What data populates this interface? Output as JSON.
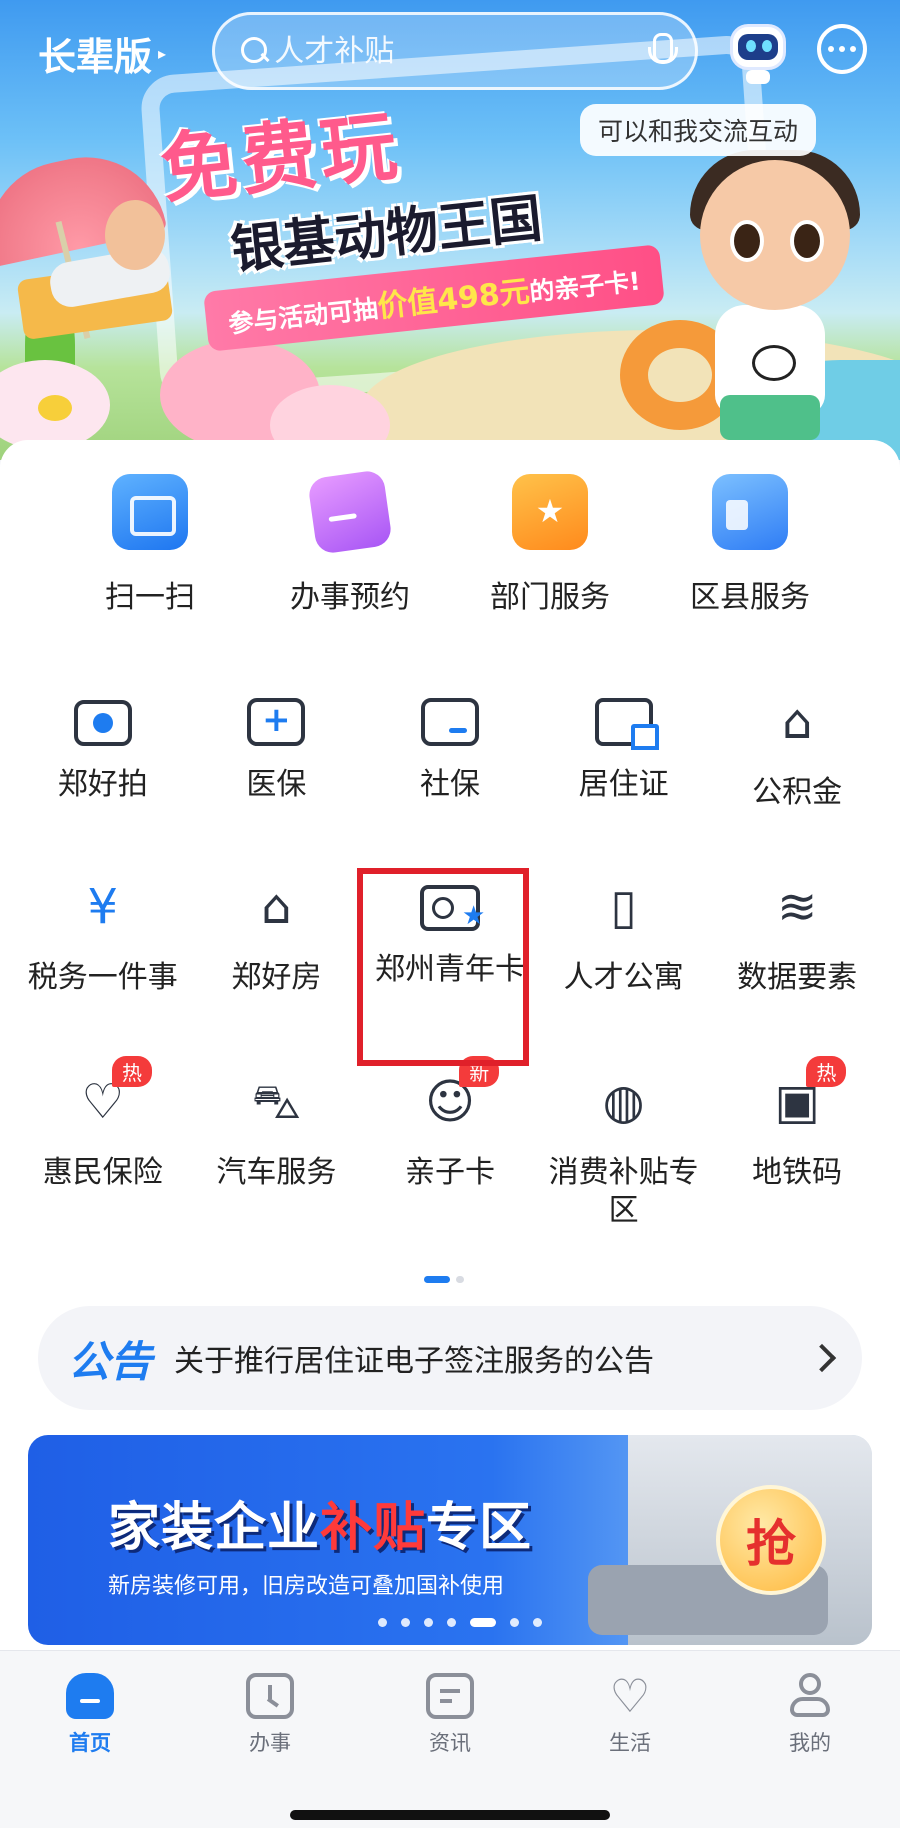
{
  "header": {
    "elder_mode": "长辈版",
    "search_placeholder": "人才补贴",
    "assistant_bubble": "可以和我交流互动"
  },
  "hero": {
    "title": "免费玩",
    "subtitle": "银基动物王国",
    "strip_prefix": "参与活动可抽",
    "strip_highlight": "价值498元",
    "strip_suffix": "的亲子卡!"
  },
  "quick_actions": [
    {
      "label": "扫一扫",
      "icon": "scan-icon"
    },
    {
      "label": "办事预约",
      "icon": "appointment-icon"
    },
    {
      "label": "部门服务",
      "icon": "department-icon"
    },
    {
      "label": "区县服务",
      "icon": "county-icon"
    }
  ],
  "services": [
    {
      "label": "郑好拍",
      "icon": "camera-icon"
    },
    {
      "label": "医保",
      "icon": "medical-kit-icon"
    },
    {
      "label": "社保",
      "icon": "social-card-icon"
    },
    {
      "label": "居住证",
      "icon": "residence-permit-icon"
    },
    {
      "label": "公积金",
      "icon": "housing-fund-icon"
    },
    {
      "label": "税务一件事",
      "icon": "tax-icon"
    },
    {
      "label": "郑好房",
      "icon": "house-hands-icon"
    },
    {
      "label": "郑州青年卡",
      "icon": "youth-card-icon"
    },
    {
      "label": "人才公寓",
      "icon": "talent-apartment-icon"
    },
    {
      "label": "数据要素",
      "icon": "database-icon"
    },
    {
      "label": "惠民保险",
      "icon": "insurance-icon",
      "badge": "热"
    },
    {
      "label": "汽车服务",
      "icon": "car-icon"
    },
    {
      "label": "亲子卡",
      "icon": "family-icon",
      "badge": "新"
    },
    {
      "label": "消费补贴专区",
      "icon": "subsidy-bag-icon"
    },
    {
      "label": "地铁码",
      "icon": "metro-icon",
      "badge": "热"
    }
  ],
  "notice": {
    "tag_a": "公",
    "tag_b": "告",
    "text": "关于推行居住证电子签注服务的公告"
  },
  "ad_banner": {
    "title_a": "家装企业",
    "title_b": "补贴",
    "title_c": "专区",
    "subtitle": "新房装修可用，旧房改造可叠加国补使用",
    "grab": "抢"
  },
  "tabbar": [
    {
      "label": "首页",
      "active": true
    },
    {
      "label": "办事",
      "active": false
    },
    {
      "label": "资讯",
      "active": false
    },
    {
      "label": "生活",
      "active": false
    },
    {
      "label": "我的",
      "active": false
    }
  ],
  "colors": {
    "accent": "#1e7cf0",
    "highlight_box": "#e0202a",
    "badge": "#f43b3b"
  }
}
